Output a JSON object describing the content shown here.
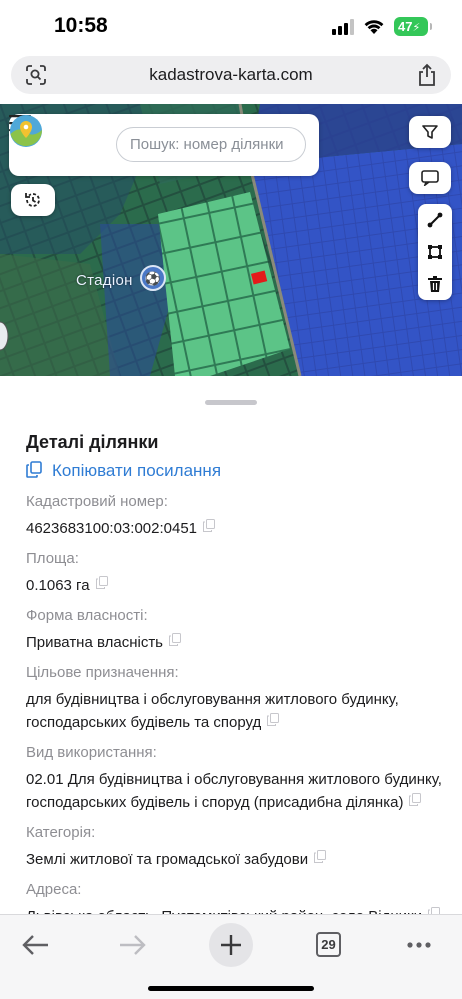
{
  "status_bar": {
    "time": "10:58",
    "battery": "47"
  },
  "browser": {
    "url": "kadastrova-karta.com"
  },
  "map": {
    "search_placeholder": "Пошук: номер ділянки",
    "place_label": "Стадіон",
    "icons": [
      "menu-icon",
      "logo-icon",
      "history-icon",
      "filter-icon",
      "comment-icon",
      "line-tool-icon",
      "polygon-tool-icon",
      "trash-icon",
      "sports-icon"
    ]
  },
  "details": {
    "title": "Деталі ділянки",
    "copy_link": "Копіювати посилання",
    "fields": [
      {
        "label": "Кадастровий номер:",
        "value": "4623683100:03:002:0451"
      },
      {
        "label": "Площа:",
        "value": "0.1063 га"
      },
      {
        "label": "Форма власності:",
        "value": "Приватна власність"
      },
      {
        "label": "Цільове призначення:",
        "value": "для будівництва і обслуговування житлового будинку, господарських будівель та споруд"
      },
      {
        "label": "Вид використання:",
        "value": "02.01 Для будівництва і обслуговування житлового будинку, господарських будівель і споруд (присадибна ділянка)"
      },
      {
        "label": "Категорія:",
        "value": "Землі житлової та громадської забудови"
      },
      {
        "label": "Адреса:",
        "value": "Львівська область, Пустомитівський район, село Відники"
      }
    ]
  },
  "toolbar": {
    "tabs_count": "29"
  },
  "colors": {
    "link": "#2f7cd4",
    "parcel_green": "#3fae6d",
    "parcel_blue": "#2e4fbf",
    "selected_parcel": "#e41b1b"
  }
}
